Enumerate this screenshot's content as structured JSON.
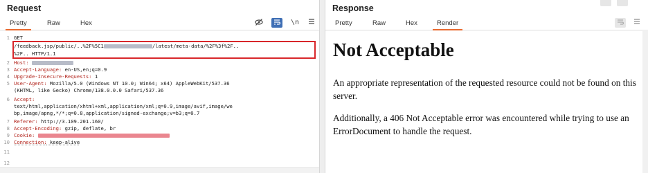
{
  "request": {
    "title": "Request",
    "tabs": [
      "Pretty",
      "Raw",
      "Hex"
    ],
    "active_tab": "Pretty",
    "toolbar": {
      "hide_icon": "eye-slash-icon",
      "wrap_icon": "wrap-lines-icon",
      "newline_label": "\\n",
      "menu_icon": "menu-icon"
    },
    "line_numbers": [
      "1",
      "",
      "",
      "2",
      "3",
      "4",
      "5",
      "",
      "6",
      "",
      "",
      "7",
      "8",
      "9",
      "10",
      "11",
      "12"
    ],
    "lines": {
      "l1": "GET",
      "l1b": "/feedback.jsp/public/..%2F%5C1",
      "l1b_tail": "/latest/meta-data/%2F%3f%2F..",
      "l1c": "%2F.. HTTP/1.1",
      "host_key": "Host:",
      "lang_key": "Accept-Language:",
      "lang_val": " en-US,en;q=0.9",
      "upg_key": "Upgrade-Insecure-Requests:",
      "upg_val": " 1",
      "ua_key": "User-Agent:",
      "ua_val": " Mozilla/5.0 (Windows NT 10.0; Win64; x64) AppleWebKit/537.36",
      "ua_val2": "(KHTML, like Gecko) Chrome/138.0.0.0 Safari/537.36",
      "accept_key": "Accept:",
      "accept_val": "text/html,application/xhtml+xml,application/xml;q=0.9,image/avif,image/we",
      "accept_val2": "bp,image/apng,*/*;q=0.8,application/signed-exchange;v=b3;q=0.7",
      "ref_key": "Referer:",
      "ref_val": " http://3.109.201.160/",
      "enc_key": "Accept-Encoding:",
      "enc_val": " gzip, deflate, br",
      "cookie_key": "Cookie:",
      "conn_key": "Connection:",
      "conn_val": " keep-alive"
    }
  },
  "response": {
    "title": "Response",
    "tabs": [
      "Pretty",
      "Raw",
      "Hex",
      "Render"
    ],
    "active_tab": "Render",
    "heading": "Not Acceptable",
    "para1": "An appropriate representation of the requested resource could not be found on this server.",
    "para2": "Additionally, a 406 Not Acceptable error was encountered while trying to use an ErrorDocument to handle the request."
  },
  "colors": {
    "accent_tab": "#e8692f",
    "highlight_box": "#d8262a",
    "header_key": "#b3261e",
    "toggle_on": "#3f6fb5"
  }
}
